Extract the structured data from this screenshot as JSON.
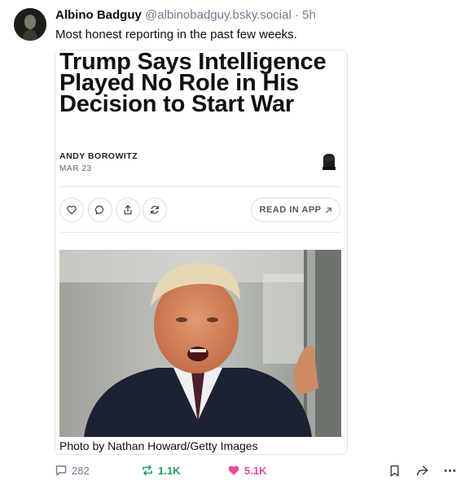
{
  "post": {
    "author_name": "Albino Badguy",
    "handle": "@albinobadguy.bsky.social",
    "separator": "·",
    "time": "5h",
    "text": "Most honest reporting in the past few weeks."
  },
  "card": {
    "headline": "Trump Says Intelligence Played No Role in His Decision to Start War",
    "byline": "ANDY BOROWITZ",
    "date": "MAR 23",
    "read_in_app_label": "READ IN APP",
    "caption": "Photo by Nathan Howard/Getty Images"
  },
  "actions": {
    "replies": "282",
    "reposts": "1.1K",
    "likes": "5.1K"
  },
  "colors": {
    "repost": "#20a162",
    "like": "#ec4899",
    "muted": "#6f7c8a"
  }
}
